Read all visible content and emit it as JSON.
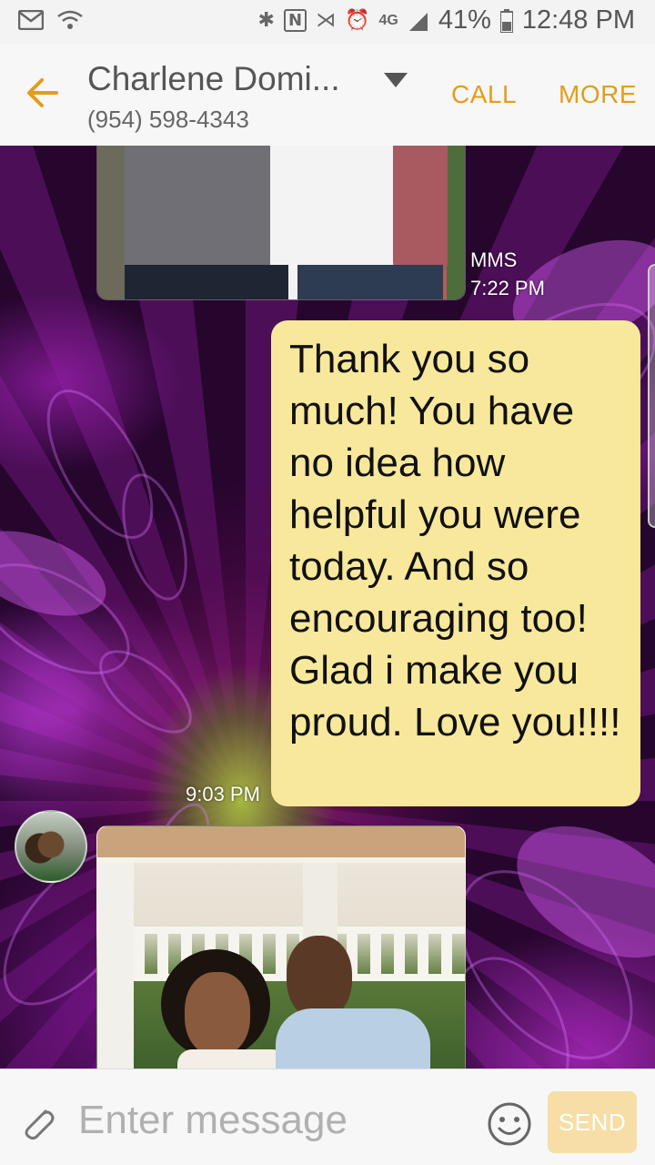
{
  "status_bar": {
    "battery": "41%",
    "time": "12:48 PM",
    "network": "4G",
    "icons": [
      "gmail-icon",
      "wifi-icon",
      "bluetooth-icon",
      "nfc-icon",
      "mute-icon",
      "alarm-icon",
      "network-icon",
      "signal-icon",
      "battery-icon"
    ]
  },
  "header": {
    "contact_name": "Charlene Domi...",
    "contact_phone": "(954) 598-4343",
    "call_label": "CALL",
    "more_label": "MORE",
    "accent_color": "#e59c1b"
  },
  "messages": [
    {
      "type": "mms",
      "direction": "received",
      "label": "MMS",
      "time": "7:22 PM"
    },
    {
      "type": "text",
      "direction": "sent",
      "text": "Thank you so much! You have no idea how helpful you were today. And so encouraging too! Glad i make you proud. Love you!!!!",
      "time": "9:03 PM",
      "bubble_color": "#f8e89c"
    },
    {
      "type": "mms",
      "direction": "received"
    }
  ],
  "composer": {
    "placeholder": "Enter message",
    "send_label": "SEND",
    "send_color": "#f6dea6"
  }
}
